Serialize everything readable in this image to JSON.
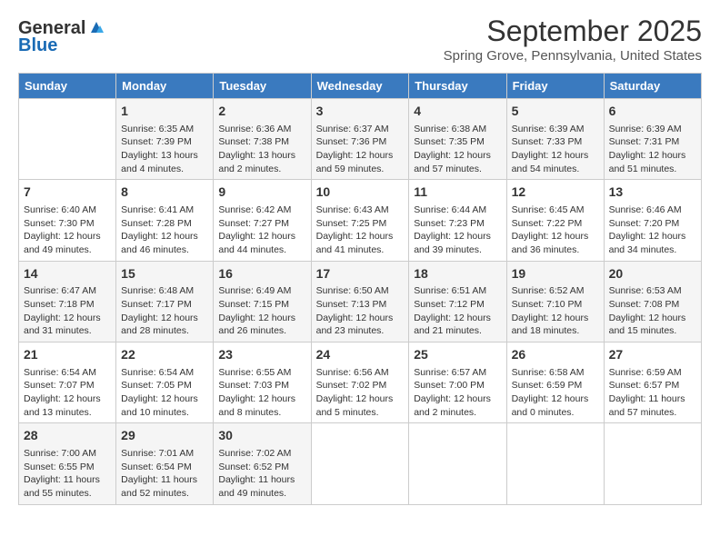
{
  "logo": {
    "line1": "General",
    "line2": "Blue"
  },
  "title": "September 2025",
  "subtitle": "Spring Grove, Pennsylvania, United States",
  "days_of_week": [
    "Sunday",
    "Monday",
    "Tuesday",
    "Wednesday",
    "Thursday",
    "Friday",
    "Saturday"
  ],
  "weeks": [
    [
      {
        "day": "",
        "content": ""
      },
      {
        "day": "1",
        "content": "Sunrise: 6:35 AM\nSunset: 7:39 PM\nDaylight: 13 hours\nand 4 minutes."
      },
      {
        "day": "2",
        "content": "Sunrise: 6:36 AM\nSunset: 7:38 PM\nDaylight: 13 hours\nand 2 minutes."
      },
      {
        "day": "3",
        "content": "Sunrise: 6:37 AM\nSunset: 7:36 PM\nDaylight: 12 hours\nand 59 minutes."
      },
      {
        "day": "4",
        "content": "Sunrise: 6:38 AM\nSunset: 7:35 PM\nDaylight: 12 hours\nand 57 minutes."
      },
      {
        "day": "5",
        "content": "Sunrise: 6:39 AM\nSunset: 7:33 PM\nDaylight: 12 hours\nand 54 minutes."
      },
      {
        "day": "6",
        "content": "Sunrise: 6:39 AM\nSunset: 7:31 PM\nDaylight: 12 hours\nand 51 minutes."
      }
    ],
    [
      {
        "day": "7",
        "content": "Sunrise: 6:40 AM\nSunset: 7:30 PM\nDaylight: 12 hours\nand 49 minutes."
      },
      {
        "day": "8",
        "content": "Sunrise: 6:41 AM\nSunset: 7:28 PM\nDaylight: 12 hours\nand 46 minutes."
      },
      {
        "day": "9",
        "content": "Sunrise: 6:42 AM\nSunset: 7:27 PM\nDaylight: 12 hours\nand 44 minutes."
      },
      {
        "day": "10",
        "content": "Sunrise: 6:43 AM\nSunset: 7:25 PM\nDaylight: 12 hours\nand 41 minutes."
      },
      {
        "day": "11",
        "content": "Sunrise: 6:44 AM\nSunset: 7:23 PM\nDaylight: 12 hours\nand 39 minutes."
      },
      {
        "day": "12",
        "content": "Sunrise: 6:45 AM\nSunset: 7:22 PM\nDaylight: 12 hours\nand 36 minutes."
      },
      {
        "day": "13",
        "content": "Sunrise: 6:46 AM\nSunset: 7:20 PM\nDaylight: 12 hours\nand 34 minutes."
      }
    ],
    [
      {
        "day": "14",
        "content": "Sunrise: 6:47 AM\nSunset: 7:18 PM\nDaylight: 12 hours\nand 31 minutes."
      },
      {
        "day": "15",
        "content": "Sunrise: 6:48 AM\nSunset: 7:17 PM\nDaylight: 12 hours\nand 28 minutes."
      },
      {
        "day": "16",
        "content": "Sunrise: 6:49 AM\nSunset: 7:15 PM\nDaylight: 12 hours\nand 26 minutes."
      },
      {
        "day": "17",
        "content": "Sunrise: 6:50 AM\nSunset: 7:13 PM\nDaylight: 12 hours\nand 23 minutes."
      },
      {
        "day": "18",
        "content": "Sunrise: 6:51 AM\nSunset: 7:12 PM\nDaylight: 12 hours\nand 21 minutes."
      },
      {
        "day": "19",
        "content": "Sunrise: 6:52 AM\nSunset: 7:10 PM\nDaylight: 12 hours\nand 18 minutes."
      },
      {
        "day": "20",
        "content": "Sunrise: 6:53 AM\nSunset: 7:08 PM\nDaylight: 12 hours\nand 15 minutes."
      }
    ],
    [
      {
        "day": "21",
        "content": "Sunrise: 6:54 AM\nSunset: 7:07 PM\nDaylight: 12 hours\nand 13 minutes."
      },
      {
        "day": "22",
        "content": "Sunrise: 6:54 AM\nSunset: 7:05 PM\nDaylight: 12 hours\nand 10 minutes."
      },
      {
        "day": "23",
        "content": "Sunrise: 6:55 AM\nSunset: 7:03 PM\nDaylight: 12 hours\nand 8 minutes."
      },
      {
        "day": "24",
        "content": "Sunrise: 6:56 AM\nSunset: 7:02 PM\nDaylight: 12 hours\nand 5 minutes."
      },
      {
        "day": "25",
        "content": "Sunrise: 6:57 AM\nSunset: 7:00 PM\nDaylight: 12 hours\nand 2 minutes."
      },
      {
        "day": "26",
        "content": "Sunrise: 6:58 AM\nSunset: 6:59 PM\nDaylight: 12 hours\nand 0 minutes."
      },
      {
        "day": "27",
        "content": "Sunrise: 6:59 AM\nSunset: 6:57 PM\nDaylight: 11 hours\nand 57 minutes."
      }
    ],
    [
      {
        "day": "28",
        "content": "Sunrise: 7:00 AM\nSunset: 6:55 PM\nDaylight: 11 hours\nand 55 minutes."
      },
      {
        "day": "29",
        "content": "Sunrise: 7:01 AM\nSunset: 6:54 PM\nDaylight: 11 hours\nand 52 minutes."
      },
      {
        "day": "30",
        "content": "Sunrise: 7:02 AM\nSunset: 6:52 PM\nDaylight: 11 hours\nand 49 minutes."
      },
      {
        "day": "",
        "content": ""
      },
      {
        "day": "",
        "content": ""
      },
      {
        "day": "",
        "content": ""
      },
      {
        "day": "",
        "content": ""
      }
    ]
  ]
}
